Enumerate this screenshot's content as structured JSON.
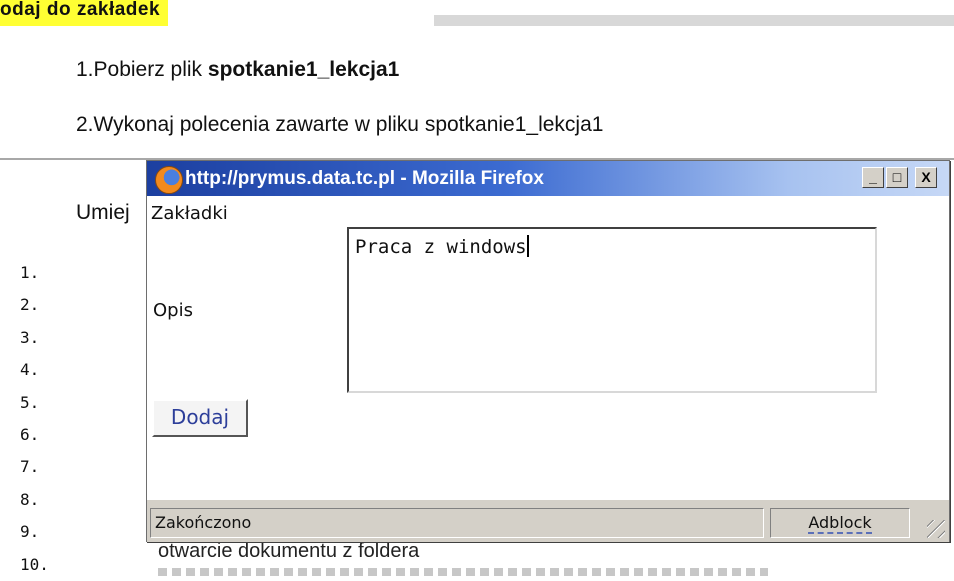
{
  "page": {
    "top_link": "odaj do zakładek",
    "steps": [
      {
        "prefix": "1.Pobierz plik ",
        "bold": "spotkanie1_lekcja1"
      },
      {
        "prefix": "2.Wykonaj polecenia zawarte w pliku spotkanie1_lekcja1"
      }
    ],
    "umiej": "Umiej",
    "list_numbers": [
      "1.",
      "2.",
      "3.",
      "4.",
      "5.",
      "6.",
      "7.",
      "8.",
      "9.",
      "10."
    ],
    "bottom_text": "otwarcie dokumentu z foldera"
  },
  "popup": {
    "title": "http://prymus.data.tc.pl - Mozilla Firefox",
    "buttons": {
      "minimize": "_",
      "maximize": "□",
      "close": "X"
    },
    "label_zakladki": "Zakładki",
    "label_opis": "Opis",
    "opis_value": "Praca z windows",
    "add_button": "Dodaj",
    "status_text": "Zakończono",
    "adblock": "Adblock"
  },
  "colors": {
    "highlight": "#ffff33",
    "titlebar": "#3c6bd1",
    "statusbar": "#d4d0c8"
  }
}
